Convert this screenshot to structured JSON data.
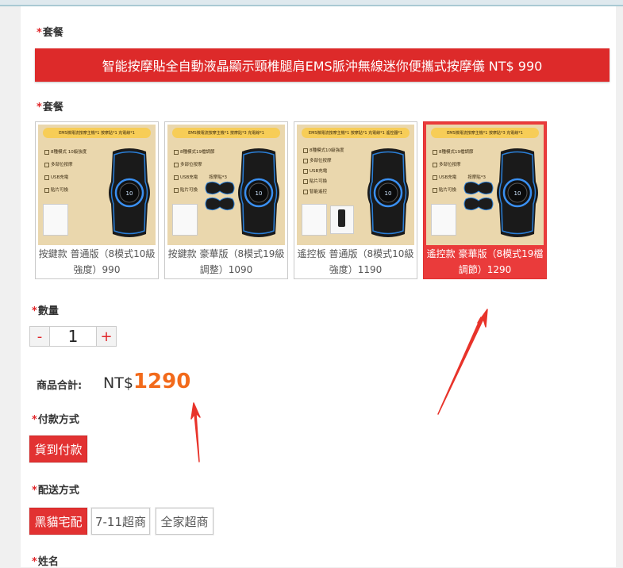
{
  "package_section_1": {
    "label": "套餐",
    "required_mark": "*"
  },
  "banner": {
    "text": "智能按摩貼全自動液晶顯示頸椎腿肩EMS脈沖無線迷你便攜式按摩儀 NT$ 990"
  },
  "package_section_2": {
    "label": "套餐",
    "required_mark": "*"
  },
  "packages": [
    {
      "img_header": "EMS微電流按摩主機*1 按摩貼*1 充電線*1",
      "features": [
        "8種模式 10級強度",
        "多部位按摩",
        "USB充電",
        "貼片可換"
      ],
      "caption": "按鍵款 普通版（8模式10級強度）990",
      "selected": false
    },
    {
      "img_header": "EMS微電流按摩主機*1 按摩貼*3 充電線*1",
      "features": [
        "8種模式19檔調節",
        "多部位按摩",
        "USB充電",
        "貼片可換"
      ],
      "extra": "按摩貼*3",
      "caption": "按鍵款 豪華版（8模式19級調整）1090",
      "selected": false
    },
    {
      "img_header": "EMS微電流按摩主機*1 按摩貼*1 充電線*1 遙控器*1",
      "features": [
        "8種模式10級強度",
        "多部位按摩",
        "USB充電",
        "貼片可換",
        "智能遙控"
      ],
      "caption": "遙控板 普通版（8模式10級強度）1190",
      "selected": false
    },
    {
      "img_header": "EMS微電流按摩主機*1 按摩貼*3 充電線*1",
      "features": [
        "8種模式19檔調節",
        "多部位按摩",
        "USB充電",
        "貼片可換"
      ],
      "extra": "按摩貼*3",
      "caption": "遙控款 豪華版（8模式19檔調節）1290",
      "selected": true
    }
  ],
  "quantity": {
    "label": "數量",
    "required_mark": "*",
    "minus": "-",
    "value": "1",
    "plus": "+"
  },
  "total": {
    "label": "商品合計:",
    "currency": "NT$",
    "amount": "1290"
  },
  "payment": {
    "label": "付款方式",
    "required_mark": "*",
    "options": [
      "貨到付款"
    ],
    "selected": "貨到付款"
  },
  "shipping": {
    "label": "配送方式",
    "required_mark": "*",
    "options": [
      "黑貓宅配",
      "7-11超商",
      "全家超商"
    ],
    "selected": "黑貓宅配"
  },
  "name_field": {
    "label": "姓名",
    "required_mark": "*"
  },
  "colors": {
    "accent_red": "#e23232",
    "price_orange": "#f26a1b",
    "arrow_red": "#e8332a"
  }
}
